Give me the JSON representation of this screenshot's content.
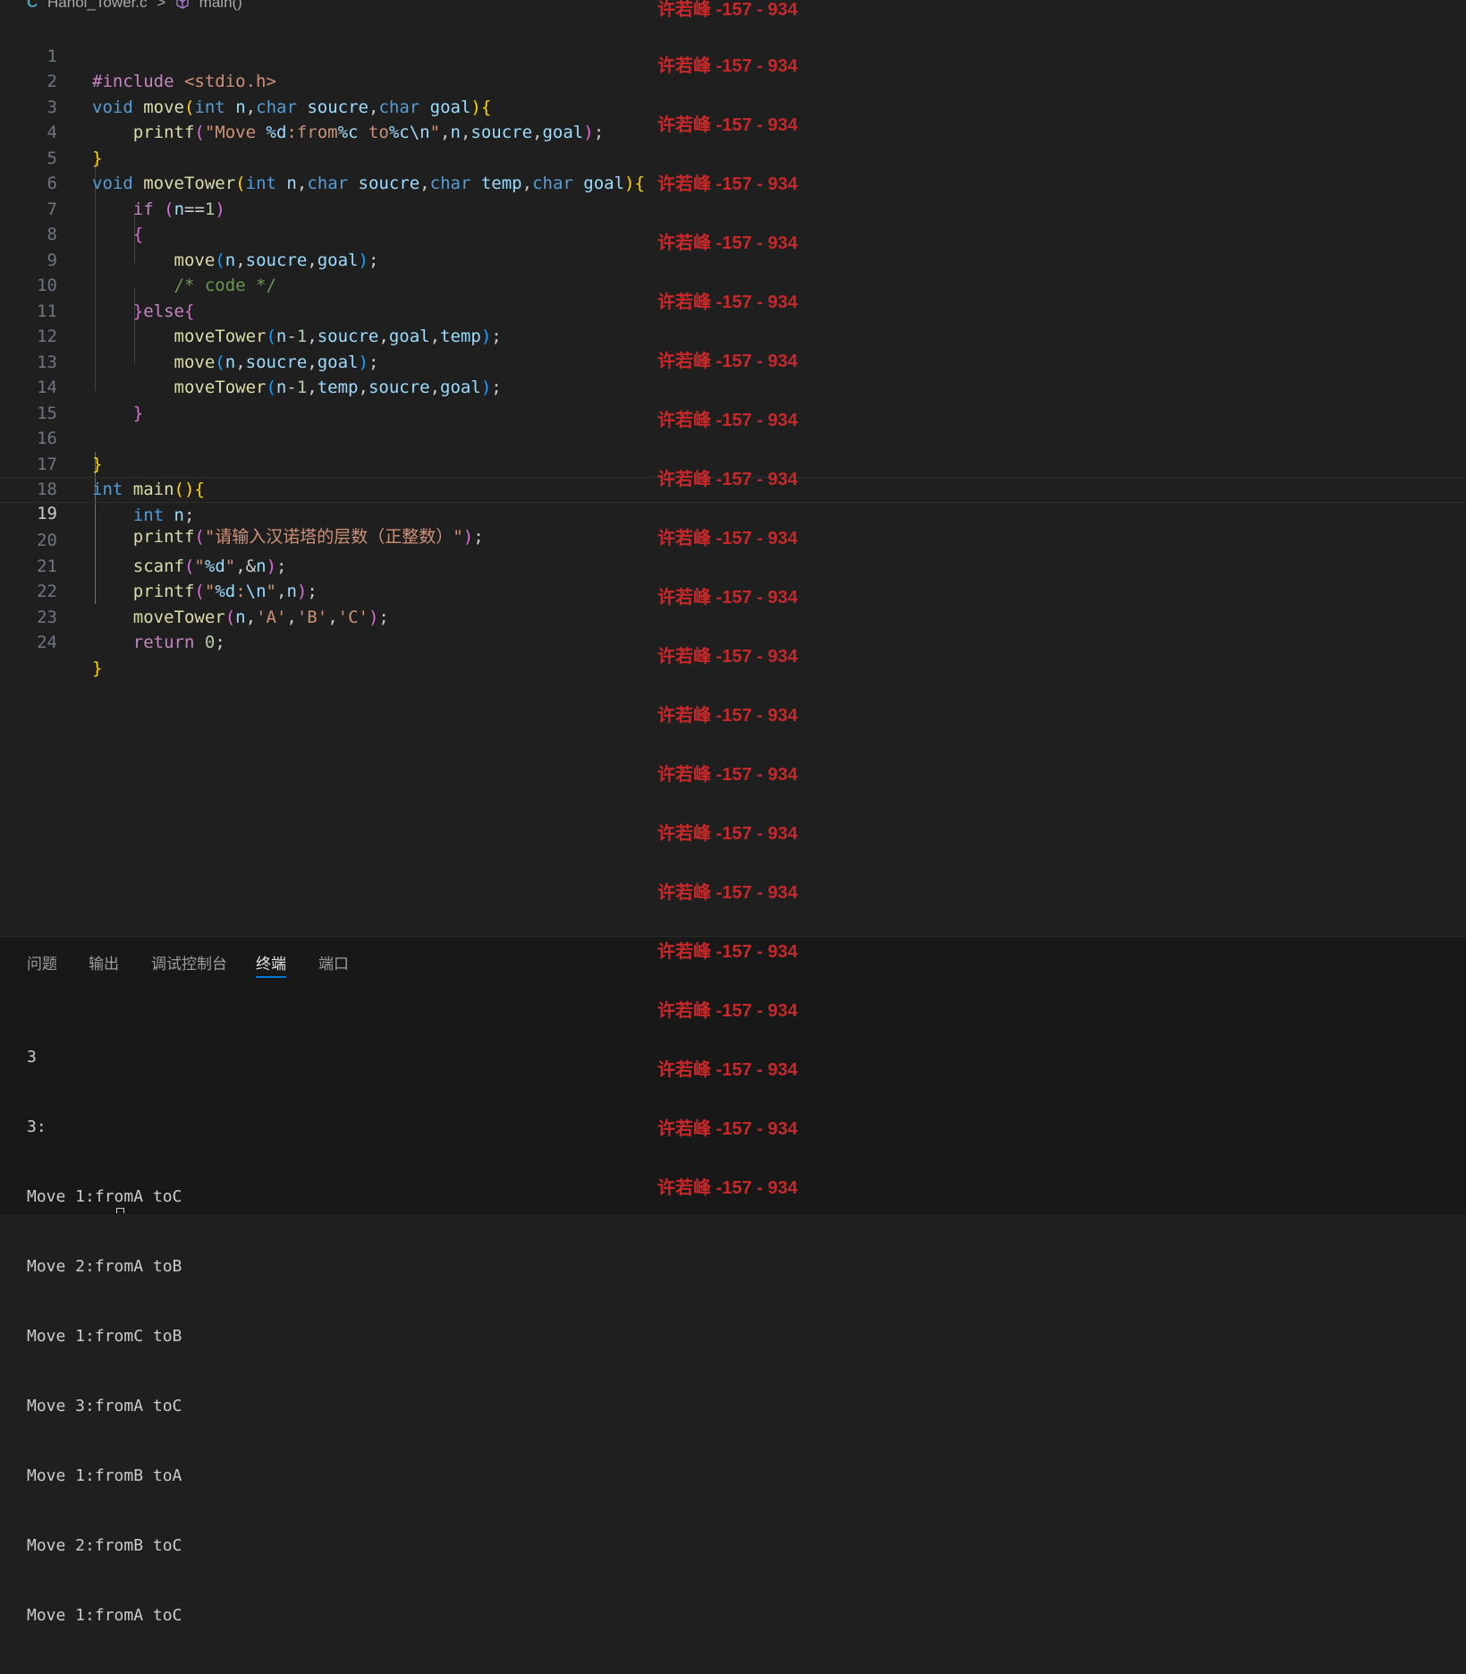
{
  "breadcrumb": {
    "file_icon": "C",
    "file_name": "Hanoi_Tower.c",
    "separator": ">",
    "symbol_icon": "cube-icon",
    "symbol_name": "main()"
  },
  "editor": {
    "active_line": 19,
    "line_numbers": [
      "1",
      "2",
      "3",
      "4",
      "5",
      "6",
      "7",
      "8",
      "9",
      "10",
      "11",
      "12",
      "13",
      "14",
      "15",
      "16",
      "17",
      "18",
      "19",
      "20",
      "21",
      "22",
      "23",
      "24"
    ],
    "lines": [
      "#include <stdio.h>",
      "void move(int n,char soucre,char goal){",
      "    printf(\"Move %d:from%c to%c\\n\",n,soucre,goal);",
      "}",
      "void moveTower(int n,char soucre,char temp,char goal){",
      "    if (n==1)",
      "    {",
      "        move(n,soucre,goal);",
      "        /* code */",
      "    }else{",
      "        moveTower(n-1,soucre,goal,temp);",
      "        move(n,soucre,goal);",
      "        moveTower(n-1,temp,soucre,goal);",
      "    }",
      "",
      "}",
      "int main(){",
      "    int n;",
      "    printf(\"请输入汉诺塔的层数（正整数）\");",
      "    scanf(\"%d\",&n);",
      "    printf(\"%d:\\n\",n);",
      "    moveTower(n,'A','B','C');",
      "    return 0;",
      "}"
    ]
  },
  "panel": {
    "tabs": [
      "问题",
      "输出",
      "调试控制台",
      "终端",
      "端口"
    ],
    "active_tab": "终端",
    "terminal_lines": [
      "3",
      "3:",
      "Move 1:fromA toC",
      "Move 2:fromA toB",
      "Move 1:fromC toB",
      "Move 3:fromA toC",
      "Move 1:fromB toA",
      "Move 2:fromB toC",
      "Move 1:fromA toC"
    ]
  },
  "watermark": {
    "text": "许若峰 -157 - 934",
    "color": "#c8282a"
  },
  "colors": {
    "editor_background": "#1f1f1f",
    "panel_background": "#181818",
    "active_tab_underline": "#0078d4"
  }
}
